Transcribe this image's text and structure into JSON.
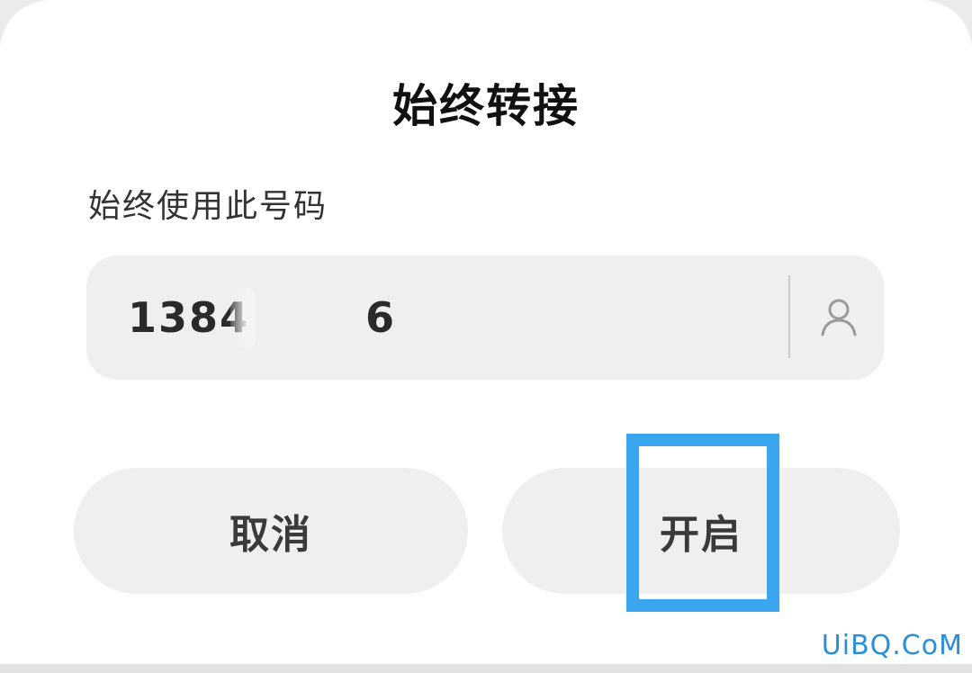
{
  "dialog": {
    "title": "始终转接",
    "field_label": "始终使用此号码",
    "phone": {
      "value_prefix": "1384",
      "value_suffix": "6"
    },
    "icons": {
      "contact": "person-icon"
    },
    "buttons": {
      "cancel_label": "取消",
      "enable_label": "开启"
    },
    "highlight_color": "#3aa6f0"
  },
  "watermark": {
    "text": "UiBQ.CoM"
  }
}
